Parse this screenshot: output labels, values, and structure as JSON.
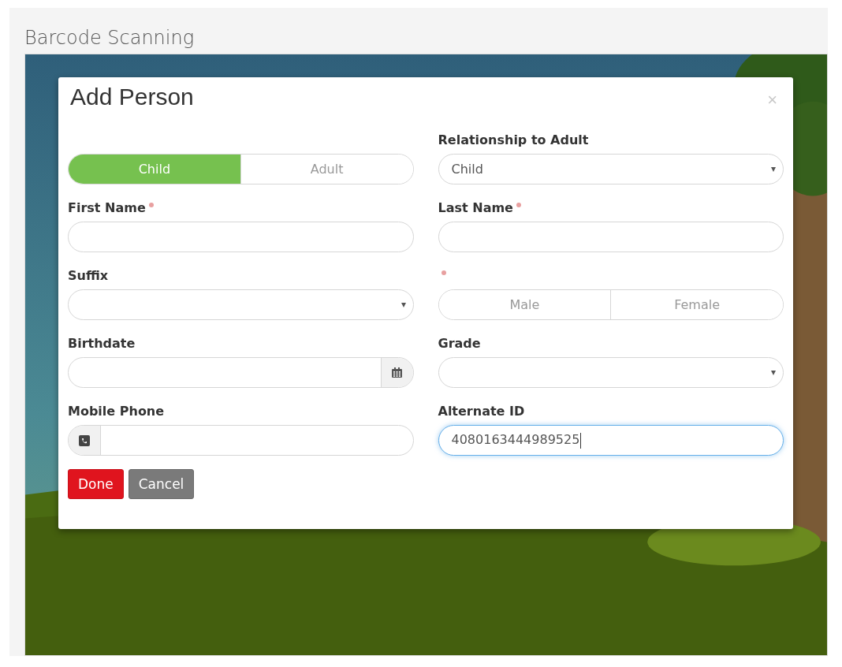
{
  "page_title": "Barcode Scanning",
  "dialog": {
    "title": "Add Person",
    "close": "×",
    "fields": [
      {
        "kind": "toggle",
        "options": [
          {
            "label": "Child",
            "selected": true
          },
          {
            "label": "Adult",
            "selected": false
          }
        ]
      },
      {
        "kind": "select",
        "label": "Relationship to Adult",
        "required": false,
        "value": "Child"
      },
      {
        "kind": "text",
        "label": "First Name",
        "required": true
      },
      {
        "kind": "text",
        "label": "Last Name",
        "required": true
      },
      {
        "kind": "select",
        "label": "Suffix",
        "required": false
      },
      {
        "kind": "toggle",
        "required": true,
        "options": [
          {
            "label": "Male",
            "selected": false
          },
          {
            "label": "Female",
            "selected": false
          }
        ]
      },
      {
        "kind": "date",
        "label": "Birthdate",
        "required": false
      },
      {
        "kind": "select",
        "label": "Grade",
        "required": false
      },
      {
        "kind": "phone",
        "label": "Mobile Phone",
        "required": false
      },
      {
        "kind": "text",
        "label": "Alternate ID",
        "required": false,
        "value": "4080163444989525",
        "focused": true
      }
    ],
    "buttons": [
      {
        "label": "Done",
        "kind": "primary"
      },
      {
        "label": "Cancel",
        "kind": "secondary"
      }
    ]
  }
}
